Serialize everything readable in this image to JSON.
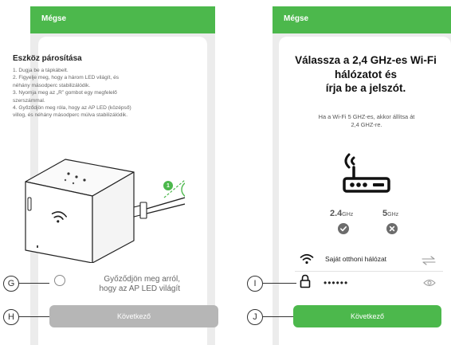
{
  "left_screen": {
    "cancel_label": "Mégse",
    "title": "Eszköz párosítása",
    "steps": [
      "1. Dugja be a tápkábelt.",
      "2. Figyelje meg, hogy a három LED világít, és",
      "néhány másodperc stabilizálódik.",
      "3. Nyomja meg az „R” gombot egy megfelelő",
      "szerszámmal.",
      "4. Győződjön meg róla, hogy az AP LED (középső)",
      "villog, és néhány másodperc múlva stabilizálódik."
    ],
    "step_marker": "1",
    "confirm_line1": "Győződjön meg arról,",
    "confirm_line2": "hogy az AP LED világít",
    "next_label": "Következő"
  },
  "right_screen": {
    "cancel_label": "Mégse",
    "heading_line1": "Válassza a 2,4 GHz-es Wi-Fi",
    "heading_line2": "hálózatot és",
    "heading_line3": "írja be a jelszót.",
    "subtext_line1": "Ha a Wi-Fi 5 GHZ-es, akkor állítsa át",
    "subtext_line2": "2,4 GHZ-re.",
    "band_24_value": "2.4",
    "band_24_unit": "GHz",
    "band_5_value": "5",
    "band_5_unit": "GHz",
    "network_name": "Saját otthoni hálózat",
    "password_masked": "••••••",
    "next_label": "Következő"
  },
  "callouts": {
    "g": "G",
    "h": "H",
    "i": "I",
    "j": "J"
  },
  "colors": {
    "brand_green": "#4cb84c",
    "disabled_gray": "#b6b6b6"
  }
}
